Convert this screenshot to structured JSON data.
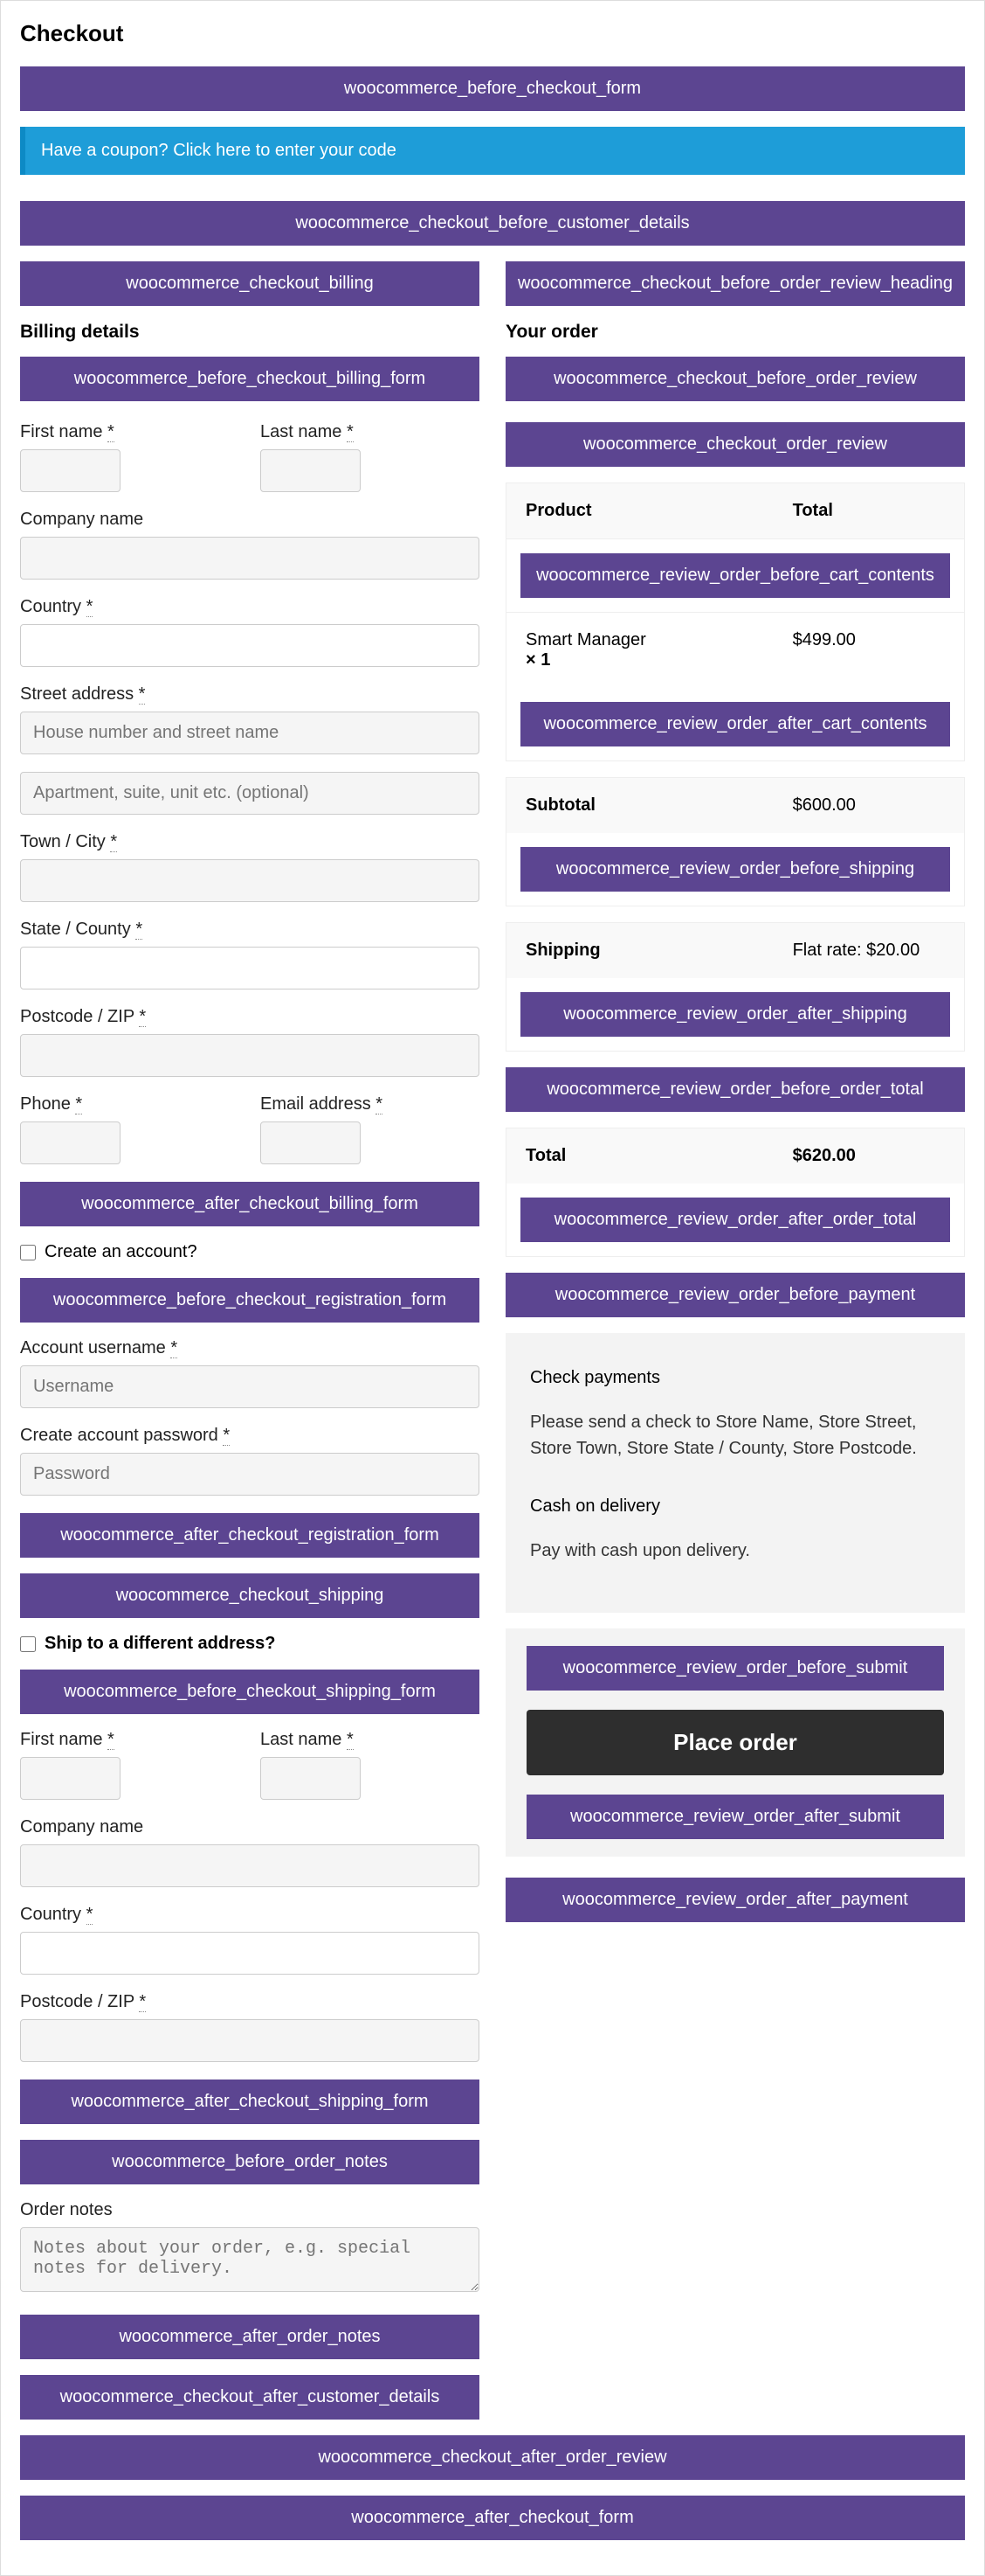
{
  "title": "Checkout",
  "hooks": {
    "before_form": "woocommerce_before_checkout_form",
    "before_customer": "woocommerce_checkout_before_customer_details",
    "billing": "woocommerce_checkout_billing",
    "before_billing_form": "woocommerce_before_checkout_billing_form",
    "after_billing_form": "woocommerce_after_checkout_billing_form",
    "before_registration": "woocommerce_before_checkout_registration_form",
    "after_registration": "woocommerce_after_checkout_registration_form",
    "shipping": "woocommerce_checkout_shipping",
    "before_shipping_form": "woocommerce_before_checkout_shipping_form",
    "after_shipping_form": "woocommerce_after_checkout_shipping_form",
    "before_order_notes": "woocommerce_before_order_notes",
    "after_order_notes": "woocommerce_after_order_notes",
    "after_customer": "woocommerce_checkout_after_customer_details",
    "before_review_heading": "woocommerce_checkout_before_order_review_heading",
    "before_order_review": "woocommerce_checkout_before_order_review",
    "order_review": "woocommerce_checkout_order_review",
    "before_cart_contents": "woocommerce_review_order_before_cart_contents",
    "after_cart_contents": "woocommerce_review_order_after_cart_contents",
    "before_shipping_review": "woocommerce_review_order_before_shipping",
    "after_shipping_review": "woocommerce_review_order_after_shipping",
    "before_order_total": "woocommerce_review_order_before_order_total",
    "after_order_total": "woocommerce_review_order_after_order_total",
    "before_payment": "woocommerce_review_order_before_payment",
    "before_submit": "woocommerce_review_order_before_submit",
    "after_submit": "woocommerce_review_order_after_submit",
    "after_payment": "woocommerce_review_order_after_payment",
    "after_order_review": "woocommerce_checkout_after_order_review",
    "after_form": "woocommerce_after_checkout_form"
  },
  "coupon_notice": "Have a coupon? Click here to enter your code",
  "billing": {
    "heading": "Billing details",
    "first_name": "First name",
    "last_name": "Last name",
    "company": "Company name",
    "country": "Country",
    "street": "Street address",
    "street_ph1": "House number and street name",
    "street_ph2": "Apartment, suite, unit etc. (optional)",
    "town": "Town / City",
    "state": "State / County",
    "postcode": "Postcode / ZIP",
    "phone": "Phone",
    "email": "Email address",
    "req": "*"
  },
  "account": {
    "create_label": "Create an account?",
    "username_label": "Account username",
    "username_ph": "Username",
    "password_label": "Create account password",
    "password_ph": "Password"
  },
  "shipping": {
    "ship_diff": "Ship to a different address?",
    "first_name": "First name",
    "last_name": "Last name",
    "company": "Company name",
    "country": "Country",
    "postcode": "Postcode / ZIP",
    "req": "*"
  },
  "notes": {
    "label": "Order notes",
    "ph": "Notes about your order, e.g. special notes for delivery."
  },
  "order": {
    "heading": "Your order",
    "product_h": "Product",
    "total_h": "Total",
    "item_name": "Smart Manager",
    "item_qty": "× 1",
    "item_price": "$499.00",
    "subtotal_l": "Subtotal",
    "subtotal_v": "$600.00",
    "shipping_l": "Shipping",
    "shipping_v": "Flat rate: $20.00",
    "total_l": "Total",
    "total_v": "$620.00"
  },
  "payment": {
    "check_title": "Check payments",
    "check_desc": "Please send a check to Store Name, Store Street, Store Town, Store State / County, Store Postcode.",
    "cod_title": "Cash on delivery",
    "cod_desc": "Pay with cash upon delivery.",
    "place_order": "Place order"
  }
}
